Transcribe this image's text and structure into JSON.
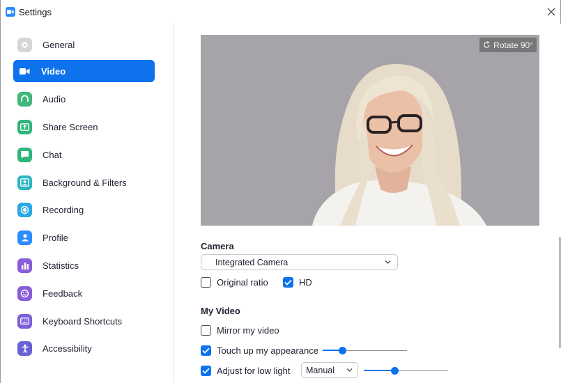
{
  "window": {
    "title": "Settings"
  },
  "sidebar": {
    "items": [
      {
        "label": "General",
        "icon": "gear-icon",
        "color": "#d8d8d8",
        "active": false
      },
      {
        "label": "Video",
        "icon": "video-camera-icon",
        "color": "#0e72ed",
        "active": true
      },
      {
        "label": "Audio",
        "icon": "headphones-icon",
        "color": "#3cb371",
        "active": false
      },
      {
        "label": "Share Screen",
        "icon": "share-screen-icon",
        "color": "#2fb67c",
        "active": false
      },
      {
        "label": "Chat",
        "icon": "chat-icon",
        "color": "#2fb67c",
        "active": false
      },
      {
        "label": "Background & Filters",
        "icon": "background-icon",
        "color": "#2bb5c2",
        "active": false
      },
      {
        "label": "Recording",
        "icon": "recording-icon",
        "color": "#2ba7e8",
        "active": false
      },
      {
        "label": "Profile",
        "icon": "profile-icon",
        "color": "#2d8cff",
        "active": false
      },
      {
        "label": "Statistics",
        "icon": "statistics-icon",
        "color": "#8b5cd6",
        "active": false
      },
      {
        "label": "Feedback",
        "icon": "feedback-icon",
        "color": "#8b5cd6",
        "active": false
      },
      {
        "label": "Keyboard Shortcuts",
        "icon": "keyboard-icon",
        "color": "#7c5cd6",
        "active": false
      },
      {
        "label": "Accessibility",
        "icon": "accessibility-icon",
        "color": "#6b5fd6",
        "active": false
      }
    ]
  },
  "preview": {
    "rotate_label": "Rotate 90°"
  },
  "camera": {
    "title": "Camera",
    "selected": "Integrated Camera",
    "original_ratio": {
      "label": "Original ratio",
      "checked": false
    },
    "hd": {
      "label": "HD",
      "checked": true
    }
  },
  "my_video": {
    "title": "My Video",
    "mirror": {
      "label": "Mirror my video",
      "checked": false
    },
    "touch_up": {
      "label": "Touch up my appearance",
      "checked": true,
      "level": 0.23
    },
    "low_light": {
      "label": "Adjust for low light",
      "checked": true,
      "mode": "Manual",
      "level": 0.36
    }
  },
  "colors": {
    "accent": "#0e72ed",
    "preview_bg": "#a6a4a9"
  }
}
